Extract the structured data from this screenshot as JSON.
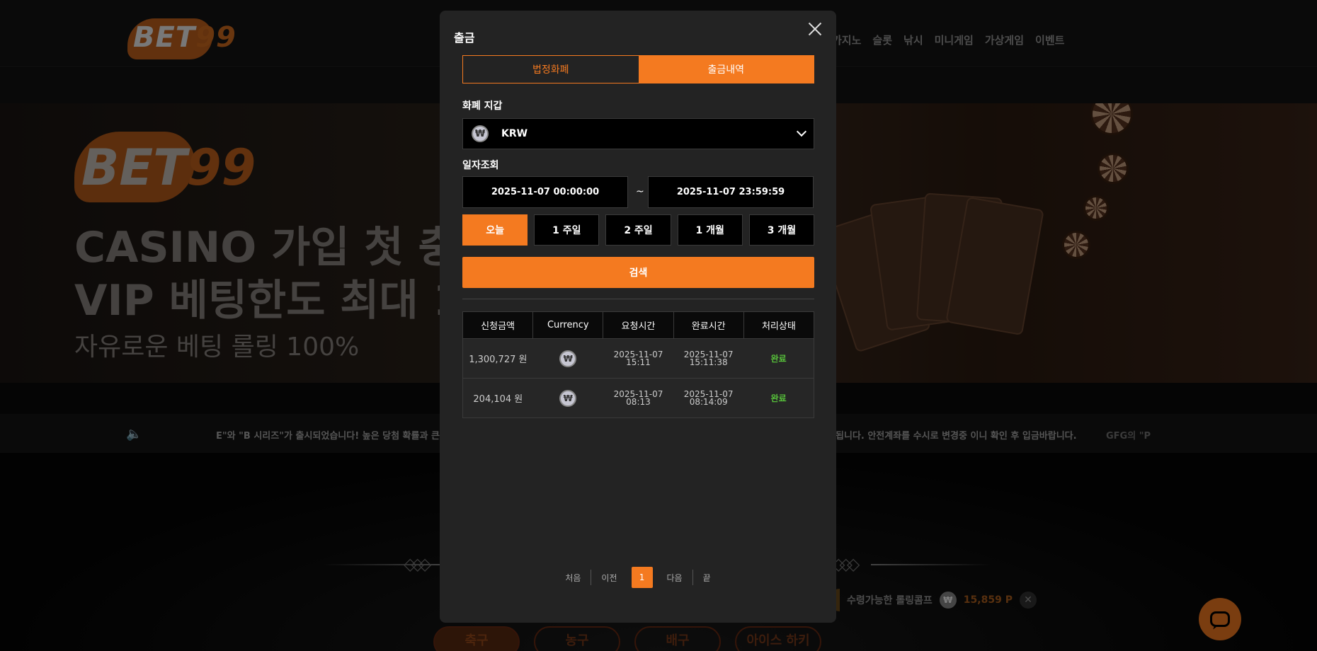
{
  "background": {
    "logo": {
      "text_a": "BET",
      "text_b": "99"
    },
    "nav": [
      "카지노",
      "슬롯",
      "낚시",
      "미니게임",
      "가상게임",
      "이벤트"
    ],
    "hero": {
      "line1": "CASINO 가입 첫 충",
      "line2": "VIP 베팅한도 최대 1",
      "line3": "자유로운 베팅 롤링 100%"
    },
    "ticker": {
      "msg": "E\"와 \"B 시리즈\"가 출시되었습니다! 높은 당첨 확률과 큰",
      "msg2": "됩니다. 안전계좌를 수시로 변경중 이니 확인 후 입금바랍니다.",
      "msg3": "GFG의 \"P"
    },
    "rolling": {
      "label": "수령가능한 롤링콤프",
      "coin": "₩",
      "amount": "15,859 P"
    },
    "sports": [
      "축구",
      "농구",
      "배구",
      "아이스 하키"
    ]
  },
  "modal": {
    "title": "출금",
    "tabs": [
      {
        "label": "법정화폐",
        "active": false
      },
      {
        "label": "출금내역",
        "active": true
      }
    ],
    "wallet_label": "화폐 지갑",
    "wallet": {
      "coin": "₩",
      "value": "KRW"
    },
    "date_label": "일자조회",
    "date_from": "2025-11-07 00:00:00",
    "date_sep": "~",
    "date_to": "2025-11-07 23:59:59",
    "periods": [
      {
        "label": "오늘",
        "active": true
      },
      {
        "label": "1 주일",
        "active": false
      },
      {
        "label": "2 주일",
        "active": false
      },
      {
        "label": "1 개월",
        "active": false
      },
      {
        "label": "3 개월",
        "active": false
      }
    ],
    "search_label": "검색",
    "table": {
      "headers": [
        "신청금액",
        "Currency",
        "요청시간",
        "완료시간",
        "처리상태"
      ],
      "rows": [
        {
          "amount": "1,300,727 원",
          "coin": "₩",
          "req_date": "2025-11-07",
          "req_time": "15:11",
          "done_date": "2025-11-07",
          "done_time": "15:11:38",
          "status": "완료"
        },
        {
          "amount": "204,104 원",
          "coin": "₩",
          "req_date": "2025-11-07",
          "req_time": "08:13",
          "done_date": "2025-11-07",
          "done_time": "08:14:09",
          "status": "완료"
        }
      ]
    },
    "pager": {
      "first": "처음",
      "prev": "이전",
      "current": "1",
      "next": "다음",
      "last": "끝"
    }
  },
  "colors": {
    "accent": "#f47a20",
    "success": "#57c13a",
    "modal_bg": "#232323"
  }
}
